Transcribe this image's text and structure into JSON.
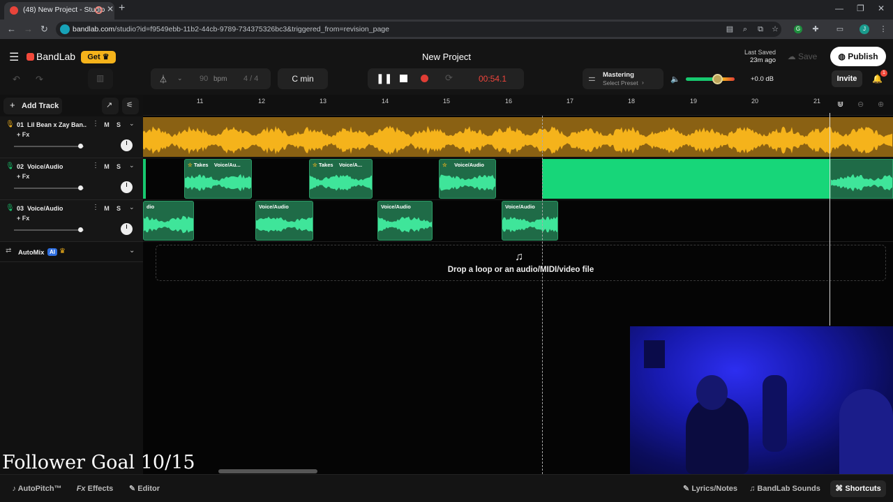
{
  "browser": {
    "tab_title": "(48) New Project - Studio",
    "url_host": "bandlab.com",
    "url_path": "/studio?id=f9549ebb-11b2-44cb-9789-734375326bc3&triggered_from=revision_page",
    "new_tab": "+",
    "min": "—",
    "max": "❐",
    "close": "✕",
    "profile_initial": "J"
  },
  "header": {
    "brand": "BandLab",
    "get_label": "Get",
    "project_title": "New Project",
    "last_saved_label": "Last Saved",
    "last_saved_time": "23m ago",
    "save_label": "Save",
    "publish_label": "Publish",
    "invite_label": "Invite",
    "notification_count": "1"
  },
  "transport": {
    "bpm_value": "90",
    "bpm_unit": "bpm",
    "time_signature": "4 / 4",
    "key": "C min",
    "time": "00:54.1",
    "mastering_label": "Mastering",
    "mastering_preset": "Select Preset",
    "volume_db": "+0.0 dB"
  },
  "tracks_panel": {
    "add_track_label": "Add Track",
    "automix_label": "AutoMix",
    "automix_badge": "AI"
  },
  "tracks": [
    {
      "number": "01",
      "name": "Lil Bean x Zay Ban...",
      "fx": "+ Fx",
      "mute": "M",
      "solo": "S",
      "color": "#f5b31b",
      "volume": 0.95,
      "pan": 0.5
    },
    {
      "number": "02",
      "name": "Voice/Audio",
      "fx": "+ Fx",
      "mute": "M",
      "solo": "S",
      "color": "#17c96f",
      "volume": 0.95,
      "pan": 0.5
    },
    {
      "number": "03",
      "name": "Voice/Audio",
      "fx": "+ Fx",
      "mute": "M",
      "solo": "S",
      "color": "#17c96f",
      "volume": 0.95,
      "pan": 0.5
    }
  ],
  "ruler": [
    "11",
    "12",
    "13",
    "14",
    "15",
    "16",
    "17",
    "18",
    "19",
    "20",
    "21"
  ],
  "clips": {
    "track2": [
      {
        "takes": "Takes",
        "label": "Voice/Au..."
      },
      {
        "takes": "Takes",
        "label": "Voice/A..."
      },
      {
        "takes": "",
        "label": "Voice/Audio"
      },
      {
        "takes": "",
        "label": ""
      },
      {
        "takes": "",
        "label": ""
      }
    ],
    "track3": [
      {
        "label": "dio"
      },
      {
        "label": "Voice/Audio"
      },
      {
        "label": "Voice/Audio"
      },
      {
        "label": "Voice/Audio"
      }
    ]
  },
  "drop_zone_text": "Drop a loop or an audio/MIDI/video file",
  "overlay": {
    "follower_goal": "Follower Goal 10/15"
  },
  "bottom": {
    "autopitch": "AutoPitch™",
    "effects": "Effects",
    "editor": "Editor",
    "lyrics": "Lyrics/Notes",
    "sounds": "BandLab Sounds",
    "shortcuts": "Shortcuts"
  }
}
